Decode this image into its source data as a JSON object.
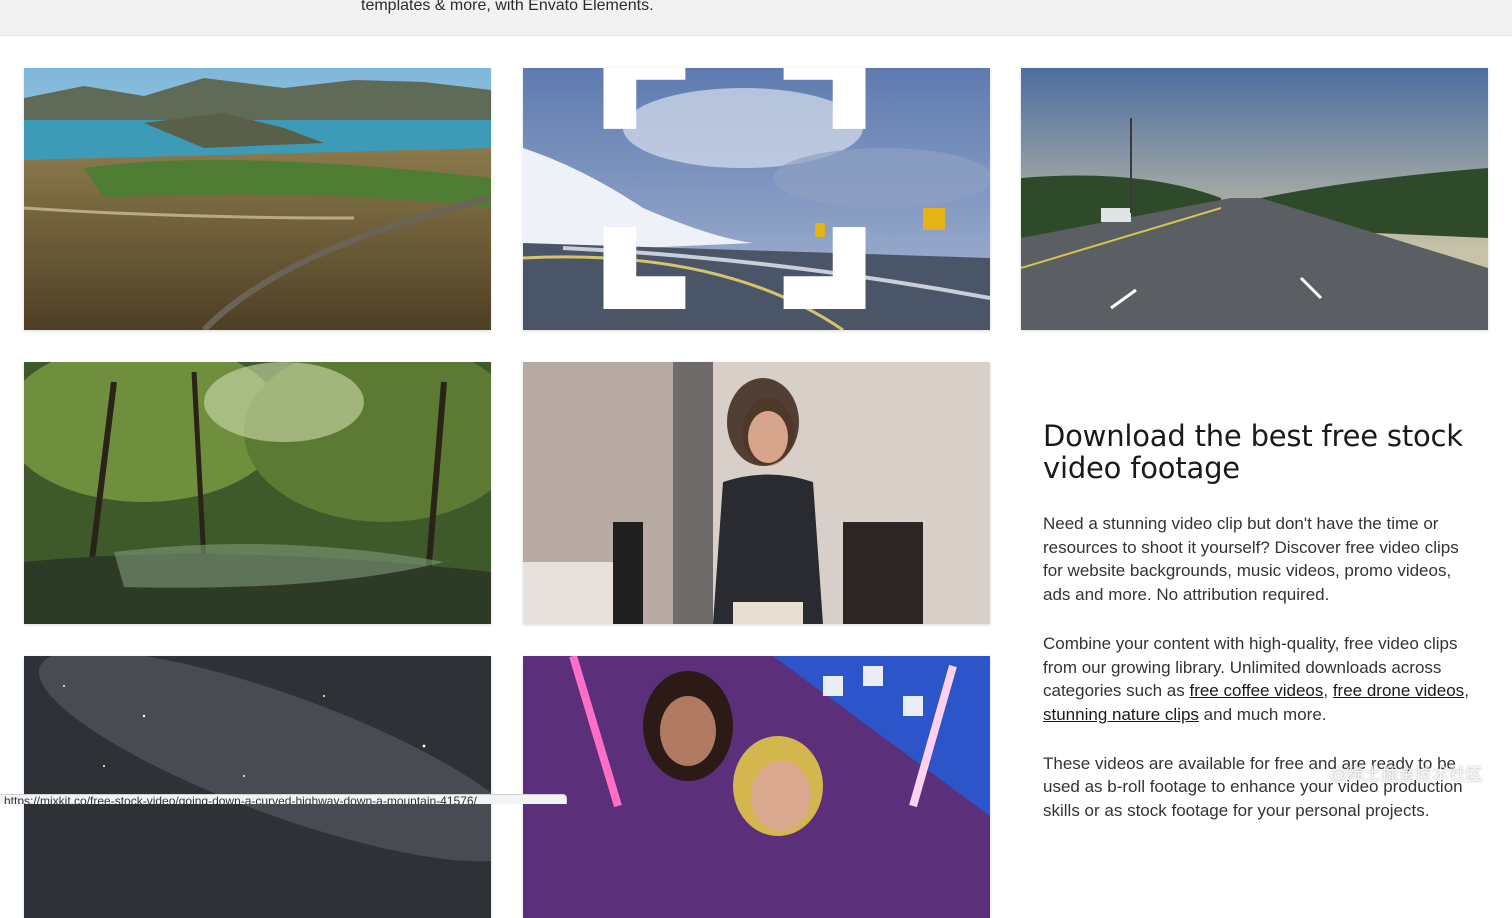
{
  "banner": {
    "text": "templates & more, with Envato Elements."
  },
  "cards": [
    {
      "name": "mountain-bay-road",
      "label": ""
    },
    {
      "name": "curved-highway-mountain",
      "label": ""
    },
    {
      "name": "highway-traffic",
      "label": ""
    },
    {
      "name": "forest-stream",
      "label": ""
    },
    {
      "name": "woman-screaming",
      "label": ""
    },
    {
      "name": "starry-sky",
      "label": ""
    },
    {
      "name": "neon-girls",
      "label": ""
    }
  ],
  "icons": {
    "expand": "expand-icon"
  },
  "content": {
    "heading": "Download the best free stock video footage",
    "para1": "Need a stunning video clip but don't have the time or resources to shoot it yourself? Discover free video clips for website backgrounds, music videos, promo videos, ads and more. No attribution required.",
    "para2_prefix": "Combine your content with high-quality, free video clips from our growing library. Unlimited downloads across categories such as ",
    "link_coffee": "free coffee videos",
    "sep1": ", ",
    "link_drone": "free drone videos",
    "sep2": ", ",
    "link_nature": "stunning nature clips",
    "para2_suffix": " and much more.",
    "para3": "These videos are available for free and are ready to be used as b-roll footage to enhance your video production skills or as stock footage for your personal projects."
  },
  "status_bar": {
    "url": "https://mixkit.co/free-stock-video/going-down-a-curved-highway-down-a-mountain-41576/"
  },
  "watermark": "@稀土掘金技术社区",
  "colors": {
    "banner_bg": "#f2f2f2",
    "accent": "#82b541",
    "link": "#1a1a1a"
  }
}
